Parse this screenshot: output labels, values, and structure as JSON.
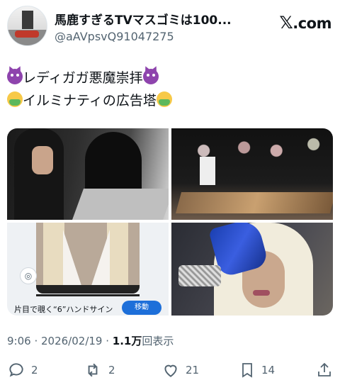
{
  "user": {
    "display_name": "馬鹿すぎるTVマスゴミは100...",
    "handle": "@aAVpsvQ91047275"
  },
  "brand": {
    "label": ".com",
    "logo": "x-logo"
  },
  "post": {
    "line1": "レディガガ悪魔崇拝",
    "line2": "イルミナティの広告塔",
    "emoji_line1": "smiling-devil-emoji",
    "emoji_line2": "nauseated-face-emoji"
  },
  "media": {
    "caption": "片目で覗く“6”ハンドサイン",
    "move_button": "移動"
  },
  "meta": {
    "time": "9:06",
    "separator": " · ",
    "date": "2026/02/19",
    "separator2": " · ",
    "views_count": "1.1万",
    "views_label": "回表示"
  },
  "actions": {
    "replies": "2",
    "reposts": "2",
    "likes": "21",
    "bookmarks": "14"
  }
}
